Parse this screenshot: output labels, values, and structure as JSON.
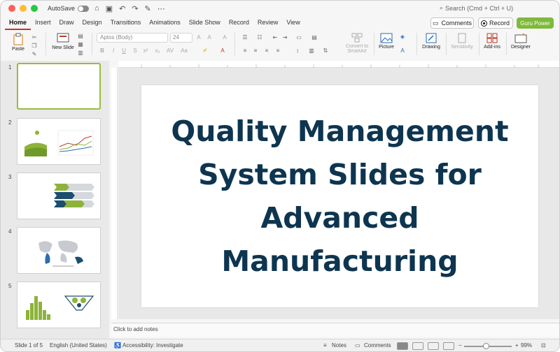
{
  "titlebar": {
    "autosave_label": "AutoSave",
    "search_label": "Search (Cmd + Ctrl + U)"
  },
  "tabs": [
    {
      "label": "Home",
      "active": true
    },
    {
      "label": "Insert"
    },
    {
      "label": "Draw"
    },
    {
      "label": "Design"
    },
    {
      "label": "Transitions"
    },
    {
      "label": "Animations"
    },
    {
      "label": "Slide Show"
    },
    {
      "label": "Record"
    },
    {
      "label": "Review"
    },
    {
      "label": "View"
    }
  ],
  "header_buttons": {
    "comments": "Comments",
    "record": "Record",
    "guru": "Guru Power"
  },
  "ribbon": {
    "paste": "Paste",
    "new_slide": "New Slide",
    "font_name": "Aptos (Body)",
    "font_size": "24",
    "convert_smartart": "Convert to SmartArt",
    "picture": "Picture",
    "drawing": "Drawing",
    "sensitivity": "Sensitivity",
    "addins": "Add-ins",
    "designer": "Designer"
  },
  "thumbnails": {
    "numbers": [
      "1",
      "2",
      "3",
      "4",
      "5"
    ],
    "selected": 1
  },
  "slide": {
    "title": "Quality Management System Slides for Advanced Manufacturing"
  },
  "notes_placeholder": "Click to add notes",
  "status": {
    "slide_info": "Slide 1 of 5",
    "language": "English (United States)",
    "accessibility": "Accessibility: Investigate",
    "notes": "Notes",
    "comments": "Comments",
    "zoom": "99%"
  },
  "colors": {
    "accent_tab": "#c0392b",
    "guru_button": "#7fb93c",
    "title_text": "#0e3550",
    "selected_thumb": "#9bbb3b"
  }
}
